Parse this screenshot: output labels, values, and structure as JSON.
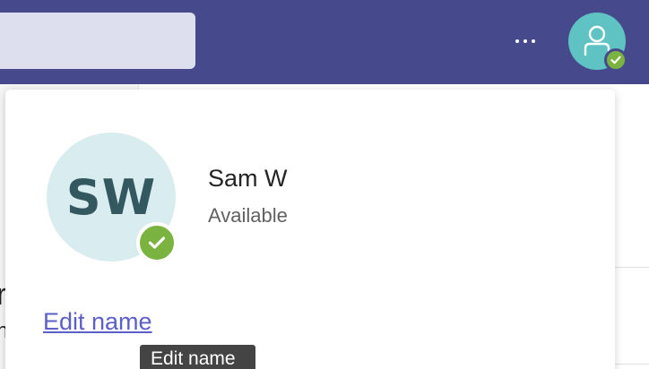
{
  "header": {
    "more_icon": "more-options-icon",
    "avatar_icon": "person-icon",
    "presence_color": "#7ab33f",
    "bar_color": "#464a8c"
  },
  "background": {
    "letter_1": "r",
    "letter_2": "n"
  },
  "profile": {
    "initials": "SW",
    "name": "Sam W",
    "status": "Available",
    "edit_link": "Edit name",
    "tooltip": "Edit name",
    "avatar_color": "#d9ecef",
    "presence_color": "#7ab33f",
    "link_color": "#5b5fc7"
  }
}
